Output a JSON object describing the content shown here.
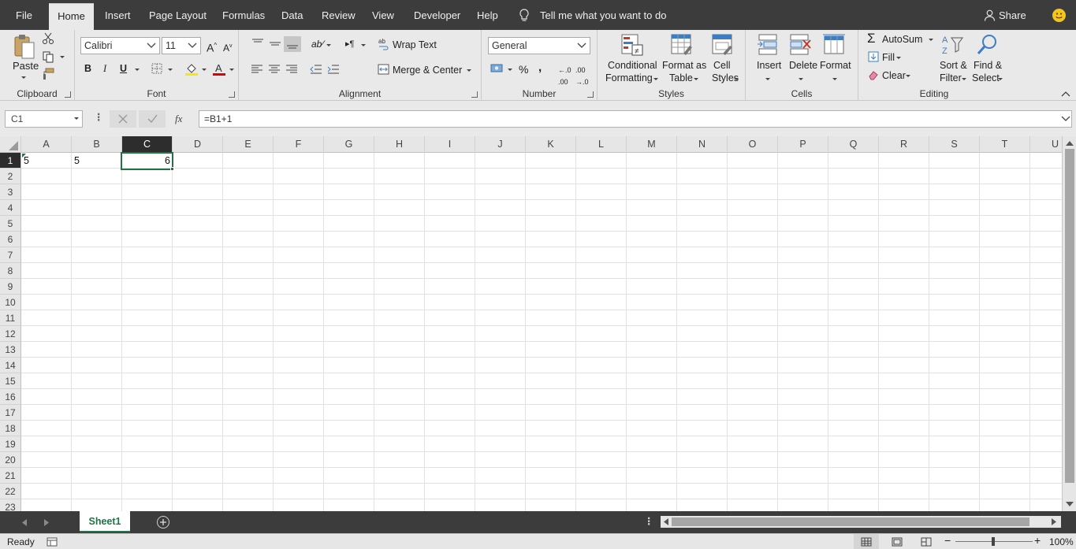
{
  "menu": {
    "tabs": [
      "File",
      "Home",
      "Insert",
      "Page Layout",
      "Formulas",
      "Data",
      "Review",
      "View",
      "Developer",
      "Help"
    ],
    "tell_me": "Tell me what you want to do",
    "share": "Share"
  },
  "ribbon": {
    "clipboard": {
      "paste": "Paste",
      "label": "Clipboard"
    },
    "font": {
      "name": "Calibri",
      "size": "11",
      "bold": "B",
      "italic": "I",
      "underline": "U",
      "label": "Font"
    },
    "alignment": {
      "wrap_text": "Wrap Text",
      "merge_center": "Merge & Center",
      "label": "Alignment"
    },
    "number": {
      "format": "General",
      "percent": "%",
      "comma": ",",
      "label": "Number"
    },
    "styles": {
      "conditional_1": "Conditional",
      "conditional_2": "Formatting",
      "format_table_1": "Format as",
      "format_table_2": "Table",
      "cell_styles_1": "Cell",
      "cell_styles_2": "Styles",
      "label": "Styles"
    },
    "cells": {
      "insert": "Insert",
      "delete": "Delete",
      "format": "Format",
      "label": "Cells"
    },
    "editing": {
      "autosum": "AutoSum",
      "fill": "Fill",
      "clear": "Clear",
      "sort_1": "Sort &",
      "sort_2": "Filter",
      "find_1": "Find &",
      "find_2": "Select",
      "label": "Editing"
    }
  },
  "formula_bar": {
    "name_box": "C1",
    "fx": "fx",
    "formula": "=B1+1"
  },
  "grid": {
    "columns": [
      "A",
      "B",
      "C",
      "D",
      "E",
      "F",
      "G",
      "H",
      "I",
      "J",
      "K",
      "L",
      "M",
      "N",
      "O",
      "P",
      "Q",
      "R",
      "S",
      "T",
      "U"
    ],
    "rows": [
      "1",
      "2",
      "3",
      "4",
      "5",
      "6",
      "7",
      "8",
      "9",
      "10",
      "11",
      "12",
      "13",
      "14",
      "15",
      "16",
      "17",
      "18",
      "19",
      "20",
      "21",
      "22",
      "23"
    ],
    "selected_column": "C",
    "selected_row": "1",
    "cells": {
      "A1": "5",
      "B1": "5",
      "C1": "6"
    }
  },
  "sheets": {
    "active": "Sheet1"
  },
  "status": {
    "ready": "Ready",
    "zoom": "100%"
  },
  "colors": {
    "excel_green": "#217346",
    "dark_chrome": "#3c3c3c",
    "ribbon_bg": "#e9e9e9"
  }
}
